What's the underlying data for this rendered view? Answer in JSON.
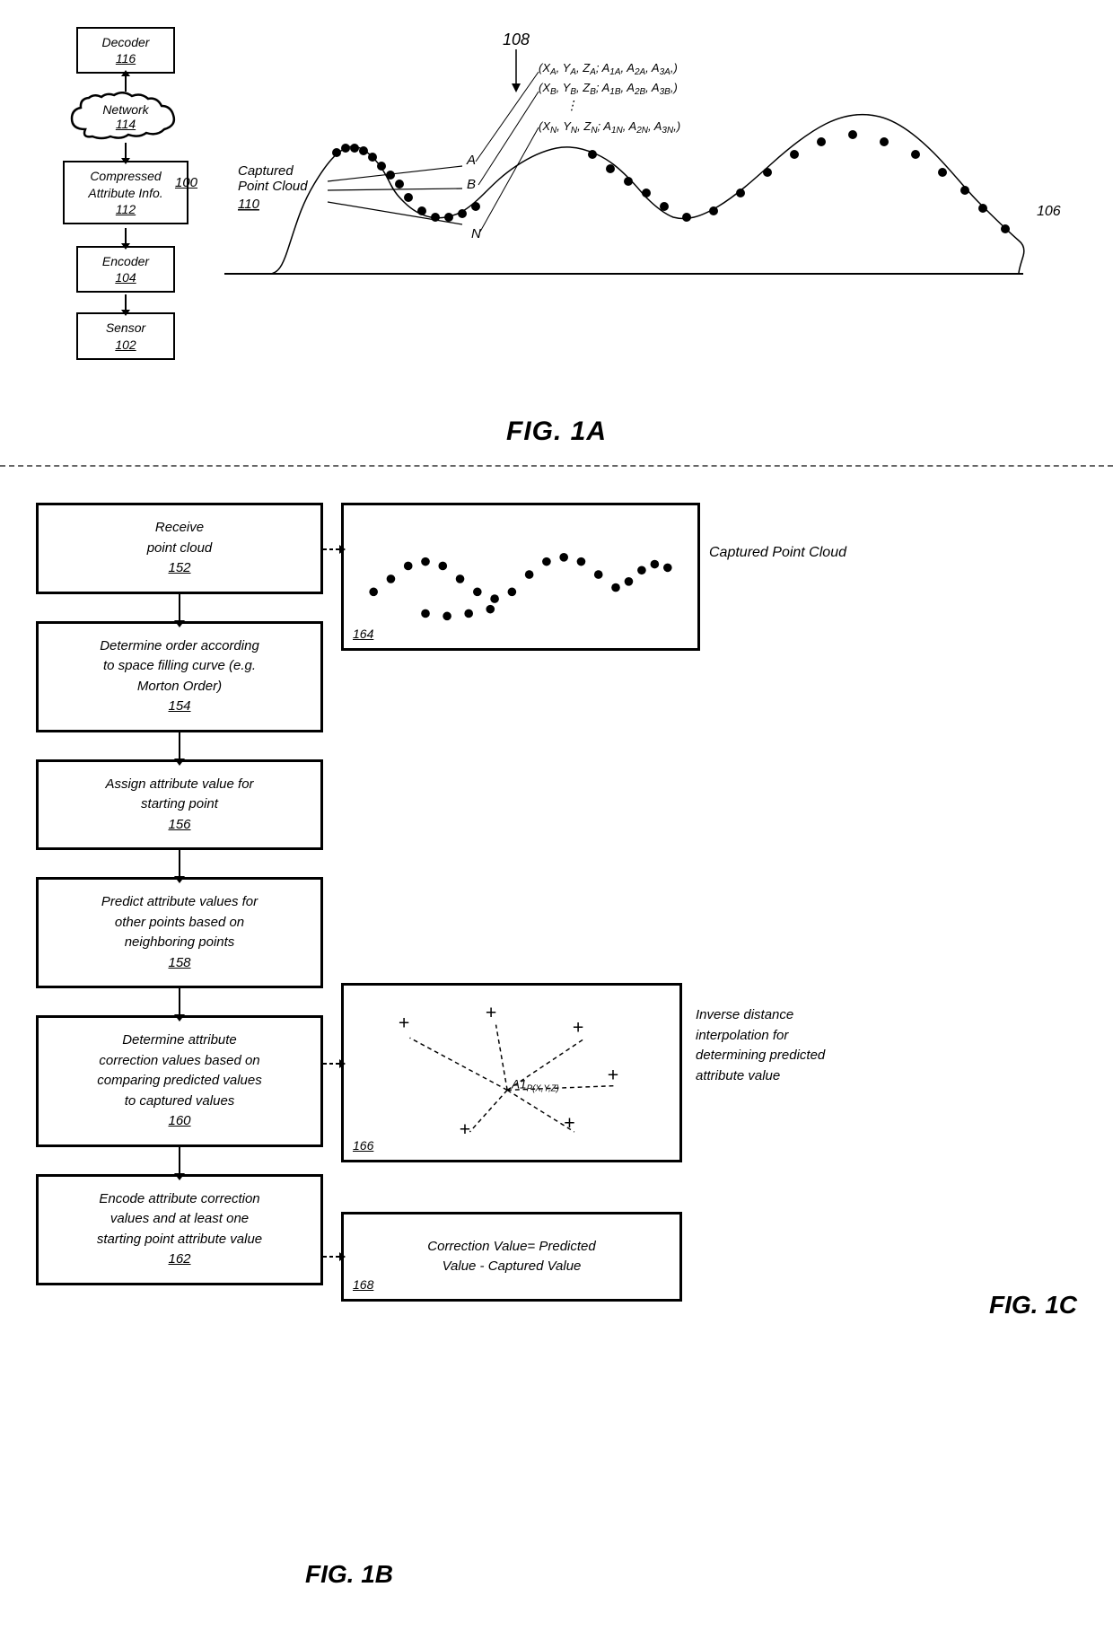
{
  "fig1a": {
    "label": "FIG. 1A",
    "ref_num": "100",
    "components": {
      "decoder": {
        "label": "Decoder",
        "ref": "116"
      },
      "network": {
        "label": "Network",
        "ref": "114"
      },
      "compressed": {
        "label": "Compressed\nAttribute Info.",
        "ref": "112"
      },
      "encoder": {
        "label": "Encoder",
        "ref": "104"
      },
      "sensor": {
        "label": "Sensor",
        "ref": "102"
      }
    },
    "point_cloud_label": "Captured\nPoint Cloud\n110",
    "ref_108": "108",
    "ref_106": "106",
    "equations": [
      "(X_A, Y_A, Z_A; A_1A, A_2A, A_3A,)",
      "(X_B, Y_B, Z_B; A_1B, A_2B, A_3B,)",
      "⋮",
      "(X_N, Y_N, Z_N; A_1N, A_2N, A_3N,)"
    ]
  },
  "fig1b": {
    "label": "FIG. 1B",
    "steps": [
      {
        "id": "152",
        "text": "Receive\npoint cloud\n152"
      },
      {
        "id": "154",
        "text": "Determine order according\nto space filling curve (e.g.\nMorton Order)\n154"
      },
      {
        "id": "156",
        "text": "Assign attribute value for\nstarting point\n156"
      },
      {
        "id": "158",
        "text": "Predict attribute values for\nother points based on\nneighboring points\n158"
      },
      {
        "id": "160",
        "text": "Determine attribute\ncorrection values based on\ncomparing predicted values\nto captured values\n160"
      },
      {
        "id": "162",
        "text": "Encode attribute correction\nvalues and at least one\nstarting point attribute value\n162"
      }
    ]
  },
  "fig1c": {
    "label": "FIG. 1C",
    "diagrams": {
      "captured_point_cloud": {
        "label": "Captured Point Cloud",
        "ref": "164"
      },
      "inverse_distance": {
        "label": "166",
        "side_label": "Inverse distance\ninterpolation for\ndetermining predicted\nattribute value",
        "point_label": "A1_P(X,Y,Z)"
      },
      "correction": {
        "label": "168",
        "text": "Correction Value= Predicted\nValue - Captured Value"
      }
    }
  }
}
